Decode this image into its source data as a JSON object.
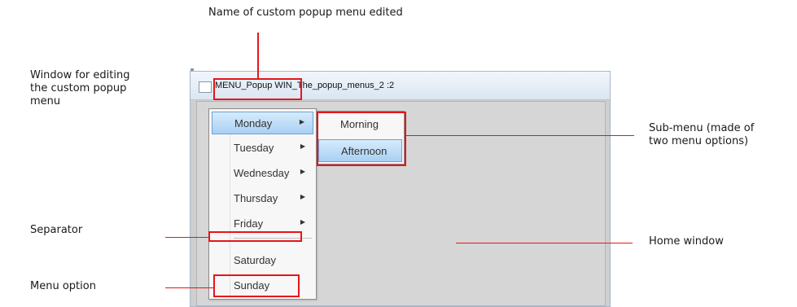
{
  "annotations": {
    "name_of_menu": "Name of custom popup menu edited",
    "window_for_editing": "Window for editing\nthe custom popup\nmenu",
    "separator": "Separator",
    "menu_option": "Menu option",
    "sub_menu": "Sub-menu (made of\ntwo menu options)",
    "home_window": "Home window"
  },
  "window": {
    "title": "MENU_Popup WIN_The_popup_menus_2 :2"
  },
  "menu": {
    "items": [
      {
        "label": "Monday",
        "has_submenu": true,
        "active": true
      },
      {
        "label": "Tuesday",
        "has_submenu": true
      },
      {
        "label": "Wednesday",
        "has_submenu": true
      },
      {
        "label": "Thursday",
        "has_submenu": true
      },
      {
        "label": "Friday",
        "has_submenu": true
      },
      {
        "label": "Saturday",
        "has_submenu": false
      },
      {
        "label": "Sunday",
        "has_submenu": false
      }
    ],
    "submenu_arrow": "▶"
  },
  "submenu": {
    "items": [
      {
        "label": "Morning"
      },
      {
        "label": "Afternoon",
        "active": true
      }
    ]
  },
  "colors": {
    "callout": "#e8141b",
    "menu_highlight": "#a8d0f3",
    "window_client": "#d6d6d6"
  }
}
